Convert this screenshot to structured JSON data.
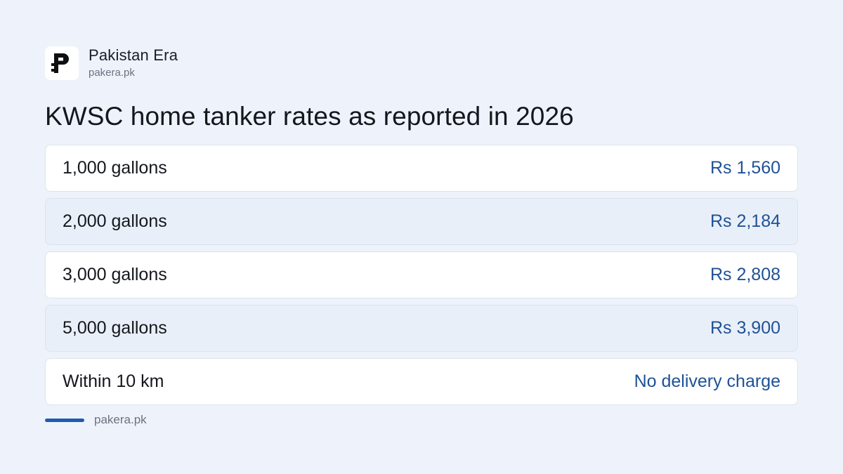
{
  "brand": {
    "name": "Pakistan Era",
    "domain": "pakera.pk",
    "logo_icon": "pakistan-era-logo-icon"
  },
  "headline": "KWSC home tanker rates as reported in 2026",
  "rows": [
    {
      "label": "1,000 gallons",
      "value": "Rs 1,560"
    },
    {
      "label": "2,000 gallons",
      "value": "Rs 2,184"
    },
    {
      "label": "3,000 gallons",
      "value": "Rs 2,808"
    },
    {
      "label": "5,000 gallons",
      "value": "Rs 3,900"
    },
    {
      "label": "Within 10 km",
      "value": "No delivery charge"
    }
  ],
  "footer": {
    "source": "pakera.pk"
  },
  "colors": {
    "background": "#eef3fb",
    "accent": "#1f5bb0",
    "value_text": "#1f5296"
  }
}
